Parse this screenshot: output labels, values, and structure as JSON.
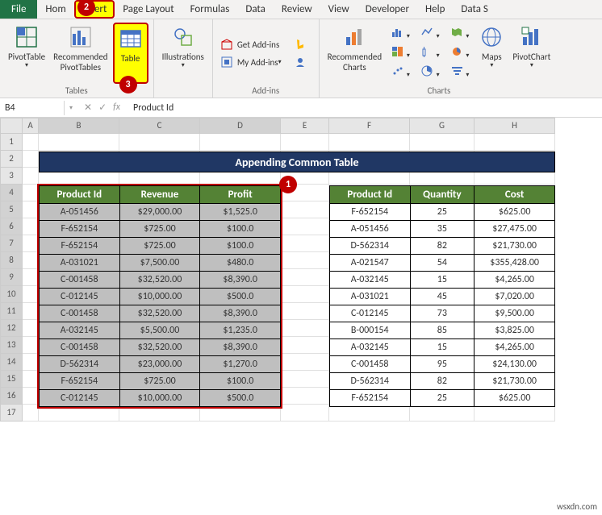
{
  "tabs": {
    "file": "File",
    "home": "Hom",
    "insert": "Insert",
    "pagelayout": "Page Layout",
    "formulas": "Formulas",
    "data": "Data",
    "review": "Review",
    "view": "View",
    "developer": "Developer",
    "help": "Help",
    "datas": "Data S"
  },
  "ribbon": {
    "tables": {
      "pivot": "PivotTable",
      "recpivot": "Recommended\nPivotTables",
      "table": "Table",
      "label": "Tables"
    },
    "illus": {
      "label": "Illustrations",
      "btn": "Illustrations"
    },
    "addins": {
      "get": "Get Add-ins",
      "my": "My Add-ins",
      "label": "Add-ins"
    },
    "charts": {
      "rec": "Recommended\nCharts",
      "maps": "Maps",
      "pivotchart": "PivotChart",
      "label": "Charts"
    }
  },
  "callouts": {
    "c1": "1",
    "c2": "2",
    "c3": "3"
  },
  "formulabar": {
    "name": "B4",
    "value": "Product Id"
  },
  "colheaders": [
    "A",
    "B",
    "C",
    "D",
    "E",
    "F",
    "G",
    "H"
  ],
  "rowheaders": [
    "1",
    "2",
    "3",
    "4",
    "5",
    "6",
    "7",
    "8",
    "9",
    "10",
    "11",
    "12",
    "13",
    "14",
    "15",
    "16",
    "17"
  ],
  "banner": "Appending Common Table",
  "table1": {
    "headers": [
      "Product Id",
      "Revenue",
      "Profit"
    ],
    "rows": [
      [
        "A-051456",
        "$29,000.00",
        "$1,525.0"
      ],
      [
        "F-652154",
        "$725.00",
        "$100.0"
      ],
      [
        "F-652154",
        "$725.00",
        "$100.0"
      ],
      [
        "A-031021",
        "$7,500.00",
        "$480.0"
      ],
      [
        "C-001458",
        "$32,520.00",
        "$8,390.0"
      ],
      [
        "C-012145",
        "$10,000.00",
        "$500.0"
      ],
      [
        "C-001458",
        "$32,520.00",
        "$8,390.0"
      ],
      [
        "A-032145",
        "$5,500.00",
        "$1,235.0"
      ],
      [
        "C-001458",
        "$32,520.00",
        "$8,390.0"
      ],
      [
        "D-562314",
        "$23,000.00",
        "$1,270.0"
      ],
      [
        "F-652154",
        "$725.00",
        "$100.0"
      ],
      [
        "C-012145",
        "$10,000.00",
        "$500.0"
      ]
    ]
  },
  "table2": {
    "headers": [
      "Product Id",
      "Quantity",
      "Cost"
    ],
    "rows": [
      [
        "F-652154",
        "25",
        "$625.00"
      ],
      [
        "A-051456",
        "35",
        "$27,475.00"
      ],
      [
        "D-562314",
        "82",
        "$21,730.00"
      ],
      [
        "A-021547",
        "54",
        "$355,428.00"
      ],
      [
        "A-032145",
        "15",
        "$4,265.00"
      ],
      [
        "A-031021",
        "45",
        "$7,020.00"
      ],
      [
        "C-012145",
        "73",
        "$9,500.00"
      ],
      [
        "B-000154",
        "85",
        "$3,825.00"
      ],
      [
        "A-032145",
        "15",
        "$4,265.00"
      ],
      [
        "C-001458",
        "95",
        "$24,130.00"
      ],
      [
        "D-562314",
        "82",
        "$21,730.00"
      ],
      [
        "F-652154",
        "25",
        "$625.00"
      ]
    ]
  },
  "watermark": "wsxdn.com"
}
